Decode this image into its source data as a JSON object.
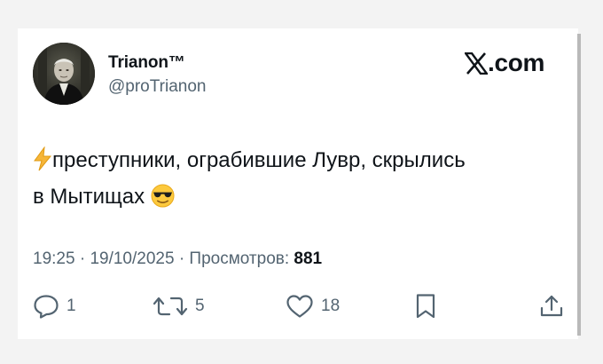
{
  "author": {
    "name": "Trianon™",
    "handle": "@proTrianon"
  },
  "source": {
    "domain": ".com",
    "logo_icon": "x-logo-icon"
  },
  "tweet": {
    "lead_emoji": "lightning-emoji",
    "text_line1": "преступники, ограбившие Лувр, скрылись",
    "text_line2": "в Мытищах",
    "trail_emoji": "sunglasses-emoji"
  },
  "meta": {
    "time": "19:25",
    "date": "19/10/2025",
    "views_label": "Просмотров:",
    "views_count": "881",
    "separator": "·"
  },
  "actions": {
    "replies": "1",
    "reposts": "5",
    "likes": "18"
  },
  "colors": {
    "text": "#0f1419",
    "secondary": "#536471",
    "background": "#f3f3f3",
    "card": "#ffffff"
  }
}
